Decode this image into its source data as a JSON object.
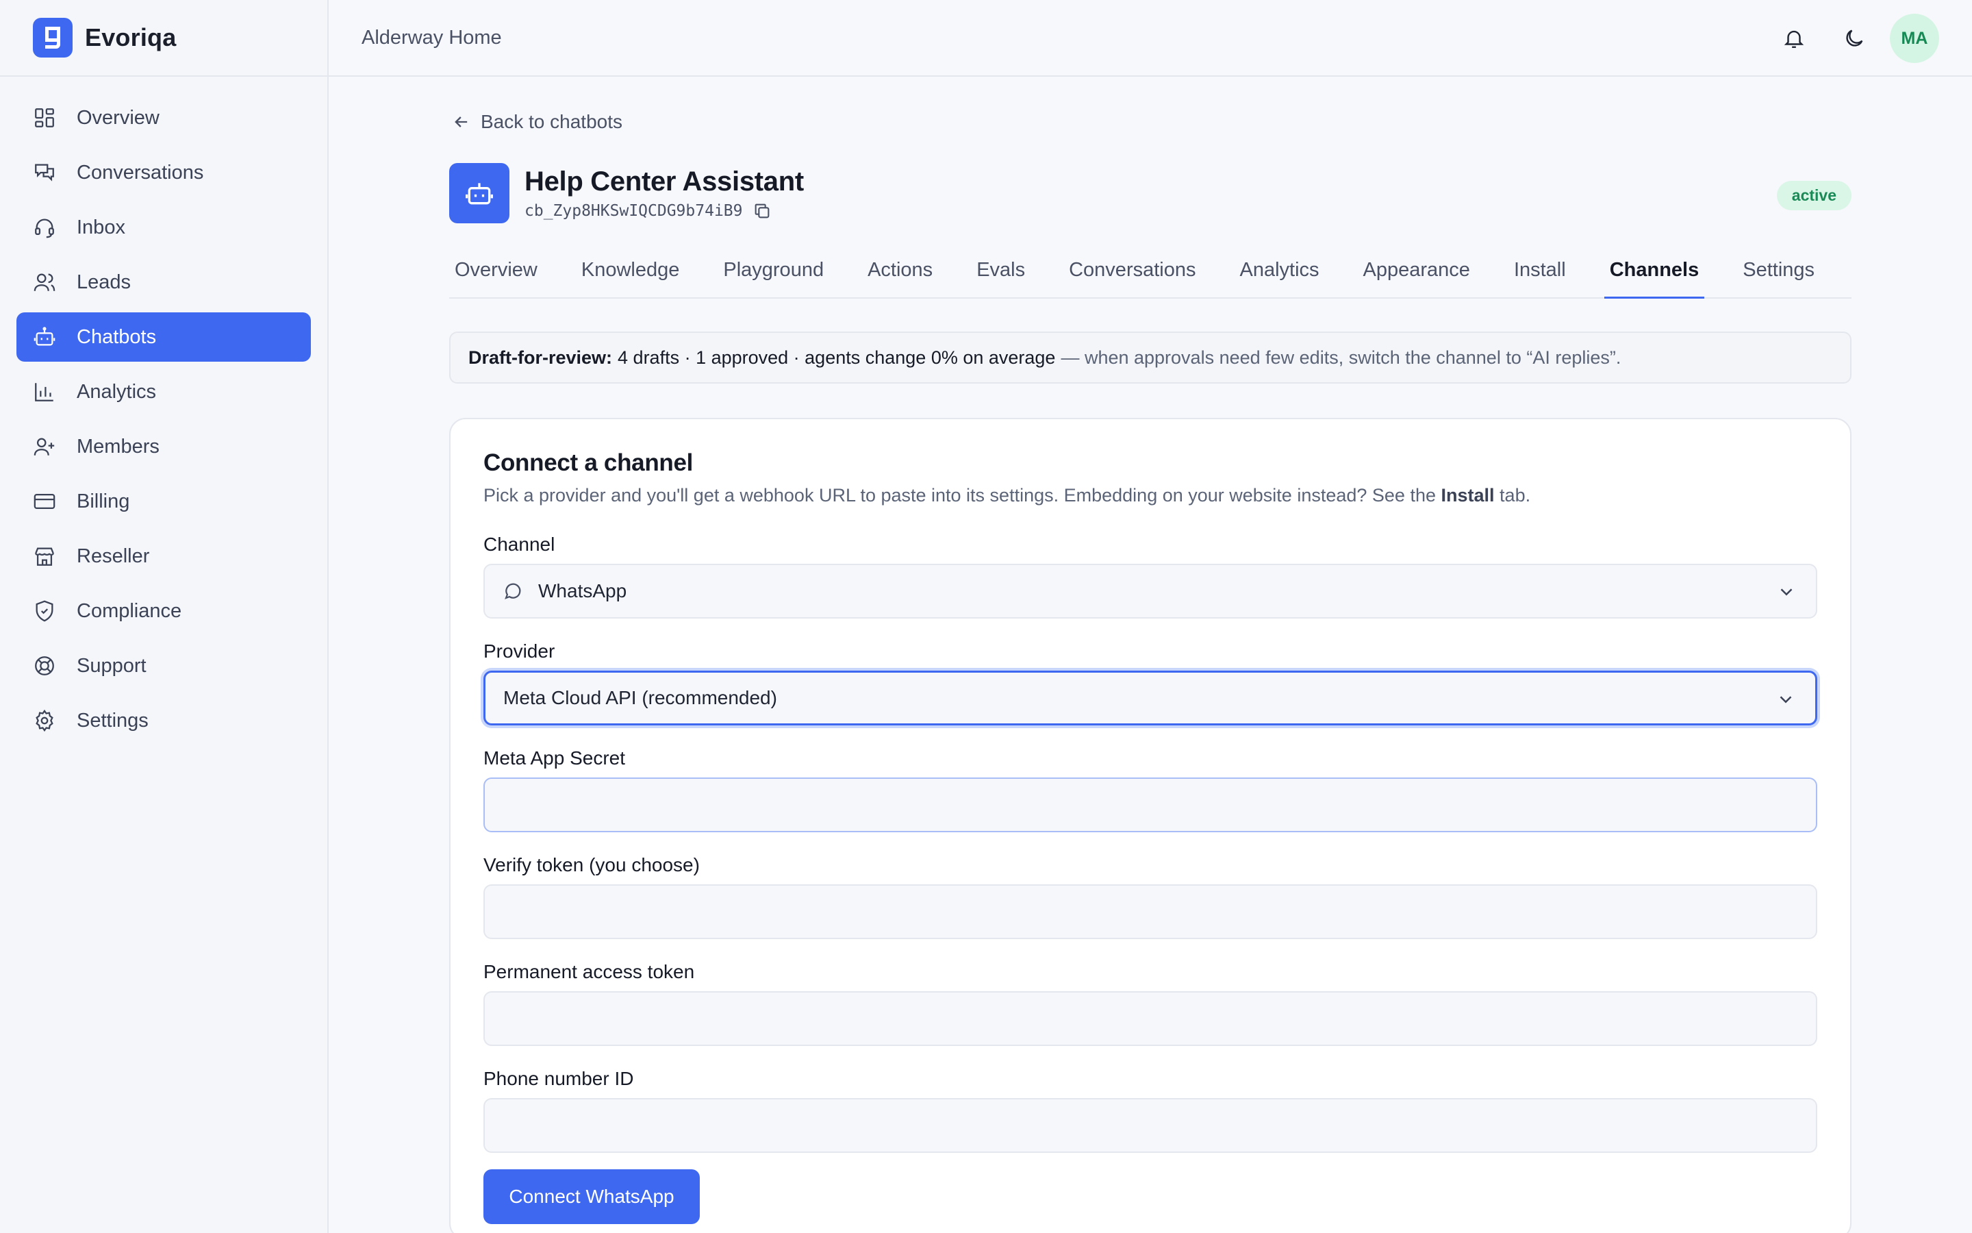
{
  "brand": {
    "name": "Evoriqa"
  },
  "sidebar": {
    "items": [
      {
        "label": "Overview",
        "icon": "dashboard-icon"
      },
      {
        "label": "Conversations",
        "icon": "chat-icon"
      },
      {
        "label": "Inbox",
        "icon": "headset-icon"
      },
      {
        "label": "Leads",
        "icon": "users-icon"
      },
      {
        "label": "Chatbots",
        "icon": "bot-icon",
        "active": true
      },
      {
        "label": "Analytics",
        "icon": "bar-chart-icon"
      },
      {
        "label": "Members",
        "icon": "user-plus-icon"
      },
      {
        "label": "Billing",
        "icon": "credit-card-icon"
      },
      {
        "label": "Reseller",
        "icon": "store-icon"
      },
      {
        "label": "Compliance",
        "icon": "shield-icon"
      },
      {
        "label": "Support",
        "icon": "lifebuoy-icon"
      },
      {
        "label": "Settings",
        "icon": "gear-icon"
      }
    ]
  },
  "topbar": {
    "org": "Alderway Home",
    "avatar_initials": "MA"
  },
  "page": {
    "back_label": "Back to chatbots",
    "bot_name": "Help Center Assistant",
    "bot_id": "cb_Zyp8HKSwIQCDG9b74iB9",
    "status": "active"
  },
  "tabs": [
    {
      "label": "Overview"
    },
    {
      "label": "Knowledge"
    },
    {
      "label": "Playground"
    },
    {
      "label": "Actions"
    },
    {
      "label": "Evals"
    },
    {
      "label": "Conversations"
    },
    {
      "label": "Analytics"
    },
    {
      "label": "Appearance"
    },
    {
      "label": "Install"
    },
    {
      "label": "Channels",
      "active": true
    },
    {
      "label": "Settings"
    }
  ],
  "notice": {
    "label": "Draft-for-review:",
    "stats": "4 drafts · 1 approved · agents change 0% on average",
    "hint": "— when approvals need few edits, switch the channel to “AI replies”."
  },
  "form": {
    "title": "Connect a channel",
    "desc_before": "Pick a provider and you'll get a webhook URL to paste into its settings. Embedding on your website instead? See the",
    "desc_bold": "Install",
    "desc_after": "tab.",
    "channel_label": "Channel",
    "channel_value": "WhatsApp",
    "provider_label": "Provider",
    "provider_value": "Meta Cloud API (recommended)",
    "secret_label": "Meta App Secret",
    "verify_label": "Verify token (you choose)",
    "access_label": "Permanent access token",
    "phone_label": "Phone number ID",
    "submit_label": "Connect WhatsApp"
  },
  "colors": {
    "accent": "#3f68f0",
    "active_badge_bg": "#d9f6e6",
    "active_badge_text": "#1a8a57"
  }
}
